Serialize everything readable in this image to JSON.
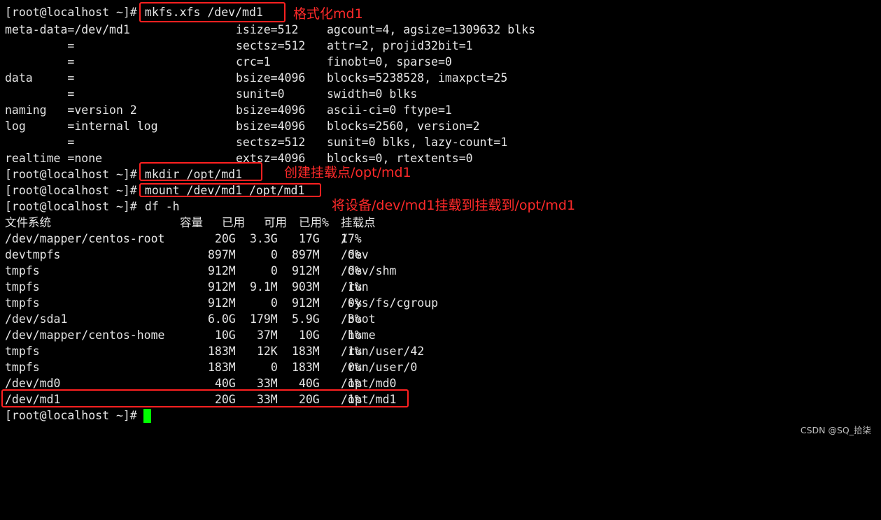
{
  "terminal": {
    "bg_color": "#000000",
    "fg_color": "#e6e6e6",
    "annotation_color": "#ff2a2a",
    "cursor_color": "#00ff00",
    "lines": [
      {
        "c0": "[root@localhost ~]#",
        "cmd": " mkfs.xfs /dev/md1"
      },
      {
        "c0": "meta-data=/dev/md1",
        "c1": "isize=512",
        "c2": "agcount=4, agsize=1309632 blks"
      },
      {
        "c0": "         =",
        "c1": "sectsz=512",
        "c2": "attr=2, projid32bit=1"
      },
      {
        "c0": "         =",
        "c1": "crc=1",
        "c2": "finobt=0, sparse=0"
      },
      {
        "c0": "data     =",
        "c1": "bsize=4096",
        "c2": "blocks=5238528, imaxpct=25"
      },
      {
        "c0": "         =",
        "c1": "sunit=0",
        "c2": "swidth=0 blks"
      },
      {
        "c0": "naming   =version 2",
        "c1": "bsize=4096",
        "c2": "ascii-ci=0 ftype=1"
      },
      {
        "c0": "log      =internal log",
        "c1": "bsize=4096",
        "c2": "blocks=2560, version=2"
      },
      {
        "c0": "         =",
        "c1": "sectsz=512",
        "c2": "sunit=0 blks, lazy-count=1"
      },
      {
        "c0": "realtime =none",
        "c1": "extsz=4096",
        "c2": "blocks=0, rtextents=0"
      },
      {
        "c0": "[root@localhost ~]#",
        "cmd": " mkdir /opt/md1"
      },
      {
        "c0": "[root@localhost ~]#",
        "cmd": " mount /dev/md1 /opt/md1"
      },
      {
        "c0": "[root@localhost ~]#",
        "cmd": " df -h"
      }
    ],
    "df_header": {
      "fs": "文件系统",
      "size": "容量",
      "used": "已用",
      "avail": "可用",
      "pct": "已用%",
      "mount": "挂载点"
    },
    "df_rows": [
      {
        "fs": "/dev/mapper/centos-root",
        "size": "20G",
        "used": "3.3G",
        "avail": "17G",
        "pct": "17%",
        "mount": "/"
      },
      {
        "fs": "devtmpfs",
        "size": "897M",
        "used": "0",
        "avail": "897M",
        "pct": "0%",
        "mount": "/dev"
      },
      {
        "fs": "tmpfs",
        "size": "912M",
        "used": "0",
        "avail": "912M",
        "pct": "0%",
        "mount": "/dev/shm"
      },
      {
        "fs": "tmpfs",
        "size": "912M",
        "used": "9.1M",
        "avail": "903M",
        "pct": "1%",
        "mount": "/run"
      },
      {
        "fs": "tmpfs",
        "size": "912M",
        "used": "0",
        "avail": "912M",
        "pct": "0%",
        "mount": "/sys/fs/cgroup"
      },
      {
        "fs": "/dev/sda1",
        "size": "6.0G",
        "used": "179M",
        "avail": "5.9G",
        "pct": "3%",
        "mount": "/boot"
      },
      {
        "fs": "/dev/mapper/centos-home",
        "size": "10G",
        "used": "37M",
        "avail": "10G",
        "pct": "1%",
        "mount": "/home"
      },
      {
        "fs": "tmpfs",
        "size": "183M",
        "used": "12K",
        "avail": "183M",
        "pct": "1%",
        "mount": "/run/user/42"
      },
      {
        "fs": "tmpfs",
        "size": "183M",
        "used": "0",
        "avail": "183M",
        "pct": "0%",
        "mount": "/run/user/0"
      },
      {
        "fs": "/dev/md0",
        "size": "40G",
        "used": "33M",
        "avail": "40G",
        "pct": "1%",
        "mount": "/opt/md0"
      },
      {
        "fs": "/dev/md1",
        "size": "20G",
        "used": "33M",
        "avail": "20G",
        "pct": "1%",
        "mount": "/opt/md1"
      }
    ],
    "final_prompt": "[root@localhost ~]#"
  },
  "annotations": {
    "format": "格式化md1",
    "mkdir": "创建挂载点/opt/md1",
    "mount": "将设备/dev/md1挂载到挂载到/opt/md1"
  },
  "watermark": "CSDN @SQ_拾柒"
}
